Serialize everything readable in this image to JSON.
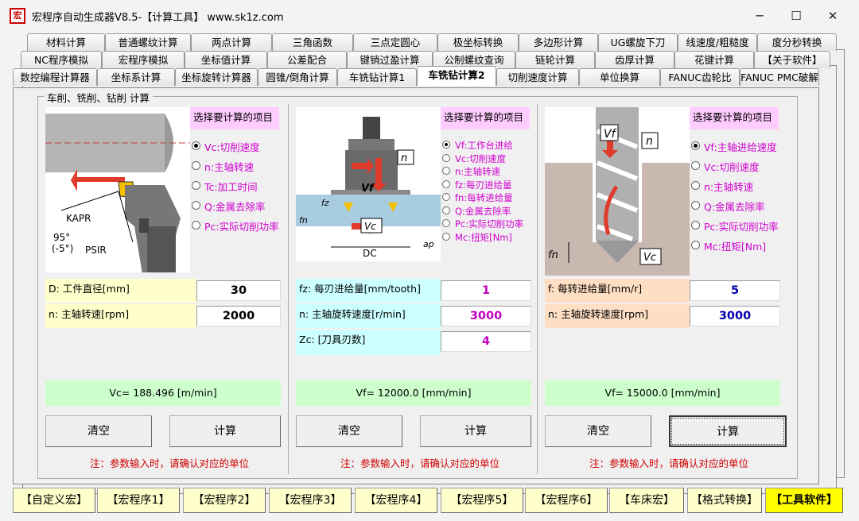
{
  "window": {
    "title": "宏程序自动生成器V8.5-【计算工具】   www.sk1z.com",
    "icon_label": "宏",
    "controls": {
      "minimize": "─",
      "maximize": "☐",
      "close": "✕"
    }
  },
  "tabs": {
    "row1": [
      "材料计算",
      "普通螺纹计算",
      "两点计算",
      "三角函数",
      "三点定圆心",
      "极坐标转换",
      "多边形计算",
      "UG螺旋下刀",
      "线速度/粗糙度",
      "度分秒转换"
    ],
    "row2": [
      "NC程序模拟",
      "宏程序模拟",
      "坐标值计算",
      "公差配合",
      "键销过盈计算",
      "公制螺纹查询",
      "链轮计算",
      "齿厚计算",
      "花键计算",
      "【关于软件】"
    ],
    "row3": [
      "数控编程计算器",
      "坐标系计算",
      "坐标旋转计算器",
      "圆锥/倒角计算",
      "车铣钻计算1",
      "车铣钻计算2",
      "切削速度计算",
      "单位换算",
      "FANUC齿轮比",
      "FANUC PMC破解"
    ],
    "active": "车铣钻计算2"
  },
  "group_title": "车削、铣削、钻削 计算",
  "turning": {
    "pick_title": "选择要计算的项目",
    "options": [
      "Vc:切削速度",
      "n:主轴转速",
      "Tc:加工时间",
      "Q:金属去除率",
      "Pc:实际切削功率"
    ],
    "selected": 0,
    "fields": [
      {
        "label": "D: 工件直径[mm]",
        "value": "30"
      },
      {
        "label": "n: 主轴转速[rpm]",
        "value": "2000"
      }
    ],
    "result": "Vc= 188.496 [m/min]",
    "clear_label": "清空",
    "calc_label": "计算",
    "note": "注：参数输入时，请确认对应的单位",
    "illus": {
      "kapr": "KAPR",
      "angle1": "95°",
      "angle2": "(-5°)",
      "psir": "PSIR"
    }
  },
  "milling": {
    "pick_title": "选择要计算的项目",
    "options": [
      "Vf:工作台进给",
      "Vc:切削速度",
      "n:主轴转速",
      "fz:每刃进给量",
      "fn:每转进给量",
      "Q:金属去除率",
      "Pc:实际切削功率",
      "Mc:扭矩[Nm]"
    ],
    "selected": 0,
    "fields": [
      {
        "label": "fz: 每刃进给量[mm/tooth]",
        "value": "1"
      },
      {
        "label": "n: 主轴旋转速度[r/min]",
        "value": "3000"
      },
      {
        "label": "Zc: [刀具刃数]",
        "value": "4"
      }
    ],
    "result": "Vf= 12000.0 [mm/min]",
    "clear_label": "清空",
    "calc_label": "计算",
    "note": "注：参数输入时，请确认对应的单位",
    "illus": {
      "n": "n",
      "vf": "Vf",
      "fz": "fz",
      "fn": "fn",
      "vc": "Vc",
      "dc": "DC",
      "ap": "ap"
    }
  },
  "drilling": {
    "pick_title": "选择要计算的项目",
    "options": [
      "Vf:主轴进给速度",
      "Vc:切削速度",
      "n:主轴转速",
      "Q:金属去除率",
      "Pc:实际切削功率",
      "Mc:扭矩[Nm]"
    ],
    "selected": 0,
    "fields": [
      {
        "label": "f: 每转进给量[mm/r]",
        "value": "5"
      },
      {
        "label": "n: 主轴旋转速度[rpm]",
        "value": "3000"
      }
    ],
    "result": "Vf= 15000.0 [mm/min]",
    "clear_label": "清空",
    "calc_label": "计算",
    "note": "注：参数输入时，请确认对应的单位",
    "illus": {
      "vf": "Vf",
      "n": "n",
      "fn": "fn",
      "vc": "Vc"
    }
  },
  "bottom_bar": [
    "【自定义宏】",
    "【宏程序1】",
    "【宏程序2】",
    "【宏程序3】",
    "【宏程序4】",
    "【宏程序5】",
    "【宏程序6】",
    "【车床宏】",
    "【格式转换】",
    "【工具软件】"
  ],
  "bottom_active": "【工具软件】"
}
